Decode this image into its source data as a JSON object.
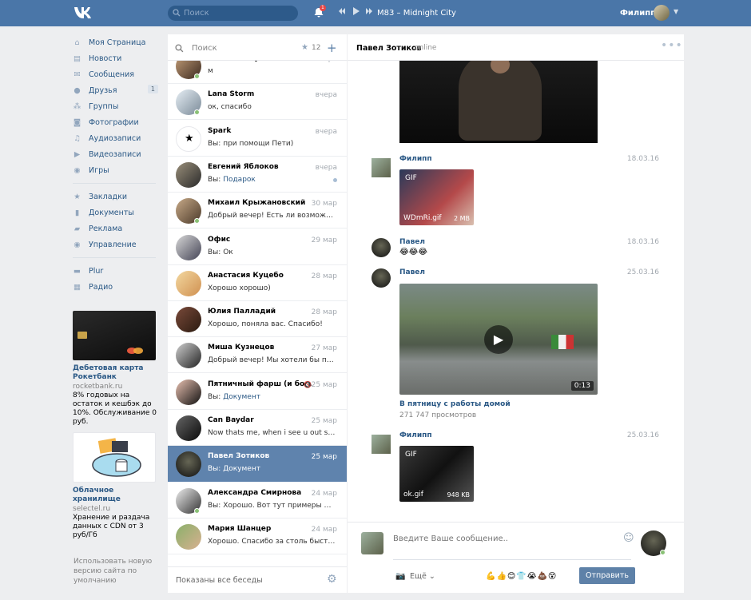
{
  "header": {
    "search_placeholder": "Поиск",
    "bell_badge": "1",
    "track": "M83 – Midnight City",
    "user_name": "Филипп"
  },
  "nav": [
    {
      "icon": "home-icon",
      "label": "Моя Страница"
    },
    {
      "icon": "news-icon",
      "label": "Новости"
    },
    {
      "icon": "messages-icon",
      "label": "Сообщения"
    },
    {
      "icon": "friends-icon",
      "label": "Друзья",
      "count": "1"
    },
    {
      "icon": "groups-icon",
      "label": "Группы"
    },
    {
      "icon": "camera-icon",
      "label": "Фотографии"
    },
    {
      "icon": "music-icon",
      "label": "Аудиозаписи"
    },
    {
      "icon": "video-icon",
      "label": "Видеозаписи"
    },
    {
      "icon": "gamepad-icon",
      "label": "Игры"
    },
    {
      "icon": "star-icon",
      "label": "Закладки"
    },
    {
      "icon": "document-icon",
      "label": "Документы"
    },
    {
      "icon": "ads-icon",
      "label": "Реклама"
    },
    {
      "icon": "gamepad-icon",
      "label": "Управление"
    },
    {
      "icon": "briefcase-icon",
      "label": "Plur"
    },
    {
      "icon": "grid-icon",
      "label": "Радио"
    }
  ],
  "ads": [
    {
      "title": "Дебетовая карта Рокетбанк",
      "domain": "rocketbank.ru",
      "text": "8% годовых на остаток и кешбэк до 10%. Обслуживание 0 руб."
    },
    {
      "title": "Облачное хранилище",
      "domain": "selectel.ru",
      "text": "Хранение и раздача данных с CDN от 3 руб/Гб"
    }
  ],
  "footer_text": "Использовать новую версию сайта по умолчанию",
  "dialogs": {
    "search_placeholder": "Поиск",
    "starred_count": "12",
    "items": [
      {
        "name": "Татьяна Плуталова",
        "msg": "м",
        "date": "вчера",
        "online": true
      },
      {
        "name": "Lana Storm",
        "msg": "ок, спасибо",
        "date": "вчера",
        "online": true
      },
      {
        "name": "Spark",
        "prefix": "Вы: ",
        "msg": "при помощи Пети)",
        "date": "вчера"
      },
      {
        "name": "Евгений Яблоков",
        "prefix": "Вы: ",
        "msg": "Подарок",
        "link": true,
        "date": "вчера",
        "unread": true
      },
      {
        "name": "Михаил Крыжановский",
        "msg": "Добрый вечер! Есть ли возможность …",
        "date": "30 мар",
        "online": true
      },
      {
        "name": "Офис",
        "prefix": "Вы: ",
        "msg": "Ок",
        "date": "29 мар"
      },
      {
        "name": "Анастасия Куцебо",
        "msg": "Хорошо хорошо)",
        "date": "28 мар"
      },
      {
        "name": "Юлия Палладий",
        "msg": "Хорошо, поняла вас. Спасибо!",
        "date": "28 мар"
      },
      {
        "name": "Миша Кузнецов",
        "msg": "Добрый вечер! Мы хотели бы пригла…",
        "date": "27 мар"
      },
      {
        "name": "Пятничный фарш (и боч…",
        "prefix": "Вы: ",
        "msg": "Документ",
        "link": true,
        "date": "25 мар",
        "muted": true
      },
      {
        "name": "Can Baydar",
        "msg": "Now thats me, when i see u out some w…",
        "date": "25 мар"
      },
      {
        "name": "Павел Зотиков",
        "prefix": "Вы: ",
        "msg": "Документ",
        "date": "25 мар",
        "selected": true
      },
      {
        "name": "Александра Смирнова",
        "prefix": "Вы: ",
        "msg": "Хорошо. Вот тут примеры — https…",
        "date": "24 мар",
        "online": true
      },
      {
        "name": "Мария Шанцер",
        "msg": "Хорошо. Спасибо за столь быстрый о…",
        "date": "24 мар"
      }
    ],
    "footer": "Показаны все беседы"
  },
  "chat": {
    "name": "Павел Зотиков",
    "status": "online",
    "messages": [
      {
        "author": "Филипп",
        "date": "18.03.16",
        "gif_label": "GIF",
        "file": "WDmRi.gif",
        "size": "2 MB"
      },
      {
        "author": "Павел",
        "date": "18.03.16",
        "text": "😂😂😂"
      },
      {
        "author": "Павел",
        "date": "25.03.16",
        "video_duration": "0:13",
        "video_title": "В пятницу с работы домой",
        "views": "271 747 просмотров"
      },
      {
        "author": "Филипп",
        "date": "25.03.16",
        "gif_label": "GIF",
        "file": "ok.gif",
        "size": "948 KB"
      }
    ],
    "compose_placeholder": "Введите Ваше сообщение..",
    "more": "Ещё",
    "emojis": "💪👍😊👕😭💩😵",
    "send": "Отправить"
  }
}
